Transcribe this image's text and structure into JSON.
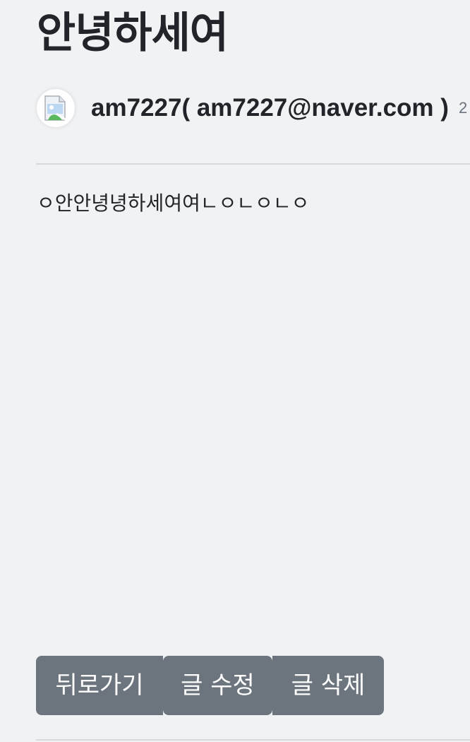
{
  "post": {
    "title": "안녕하세여",
    "author": "am7227( am7227@naver.com )",
    "date_fragment": "2",
    "body": "ㅇ안안녕녕하세여여ㄴㅇㄴㅇㄴㅇ"
  },
  "buttons": {
    "back_label": "뒤로가기",
    "edit_label": "글 수정",
    "delete_label": "글 삭제"
  },
  "icons": {
    "avatar": "broken-image-icon"
  },
  "colors": {
    "background": "#f1f2f4",
    "button": "#6c757d",
    "button_text": "#ffffff",
    "title_text": "#212529"
  }
}
